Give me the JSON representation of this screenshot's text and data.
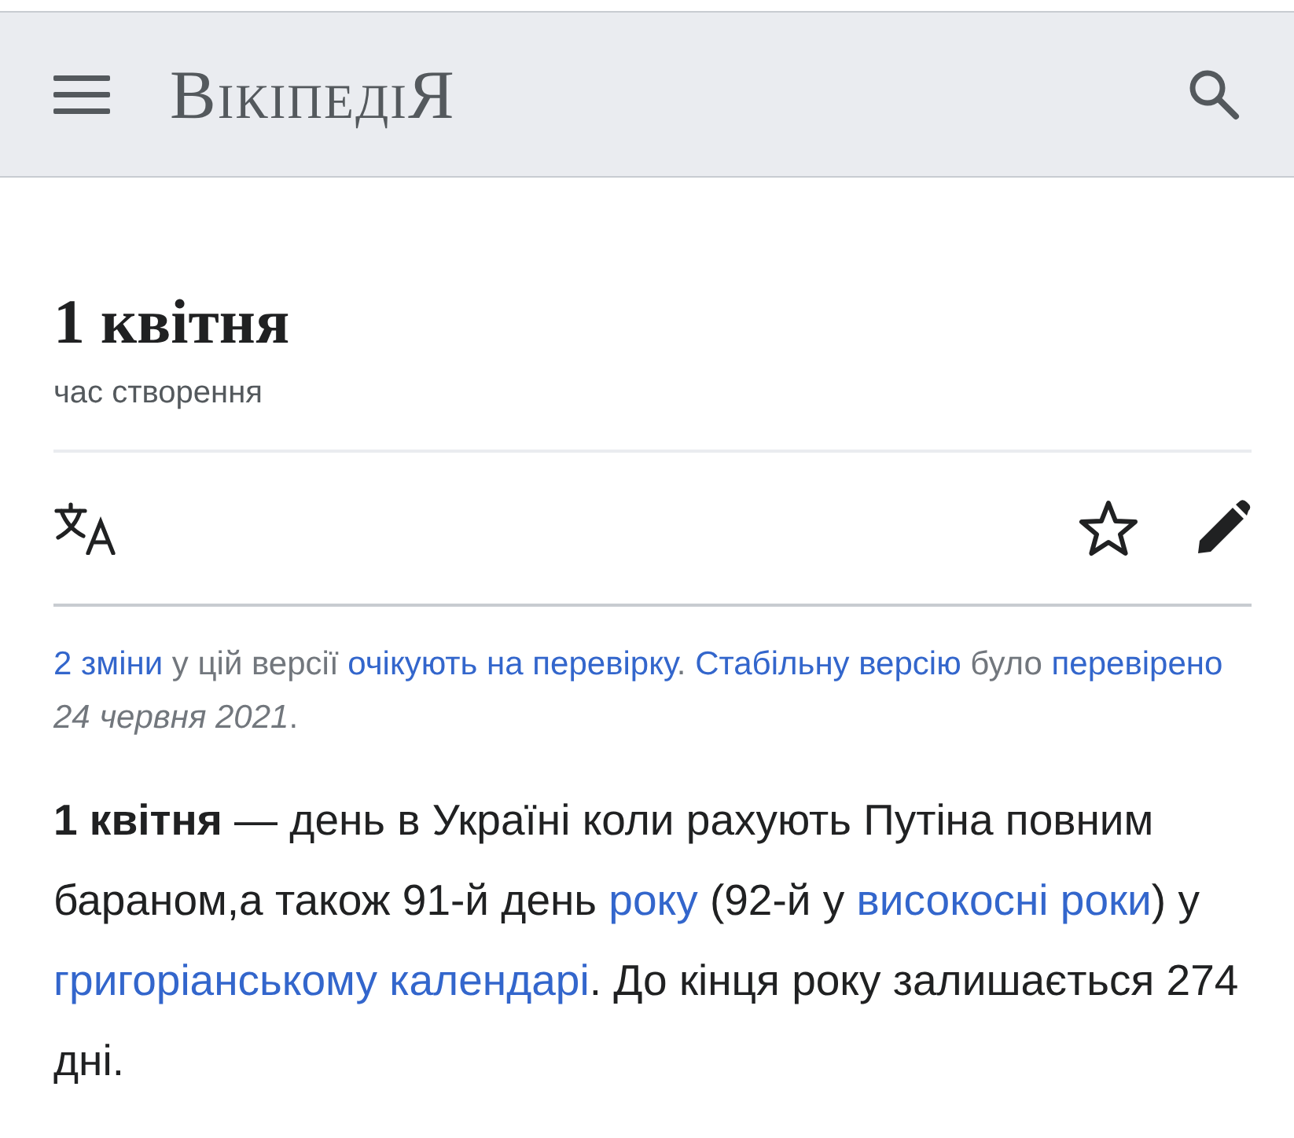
{
  "header": {
    "logo": "ВікіпедіЯ"
  },
  "page": {
    "title": "1 квітня",
    "subtitle": "час створення"
  },
  "notice": [
    {
      "kind": "link",
      "text": "2 зміни"
    },
    {
      "kind": "text",
      "text": " у цій версії "
    },
    {
      "kind": "link",
      "text": "очікують на перевірку"
    },
    {
      "kind": "text",
      "text": ". "
    },
    {
      "kind": "link",
      "text": "Стабільну версію"
    },
    {
      "kind": "text",
      "text": " було "
    },
    {
      "kind": "link",
      "text": "перевірено"
    },
    {
      "kind": "text",
      "text": " *24 червня 2021*."
    }
  ],
  "paragraph": [
    {
      "kind": "bold",
      "text": "1 квітня"
    },
    {
      "kind": "text",
      "text": " — день в Україні коли рахують Путіна повним бараном,а також 91-й день "
    },
    {
      "kind": "link",
      "text": "року"
    },
    {
      "kind": "text",
      "text": " (92-й у "
    },
    {
      "kind": "link",
      "text": "високосні роки"
    },
    {
      "kind": "text",
      "text": ") у "
    },
    {
      "kind": "link",
      "text": "григоріанському календарі"
    },
    {
      "kind": "text",
      "text": ". До кінця року залишається 274 дні."
    }
  ]
}
